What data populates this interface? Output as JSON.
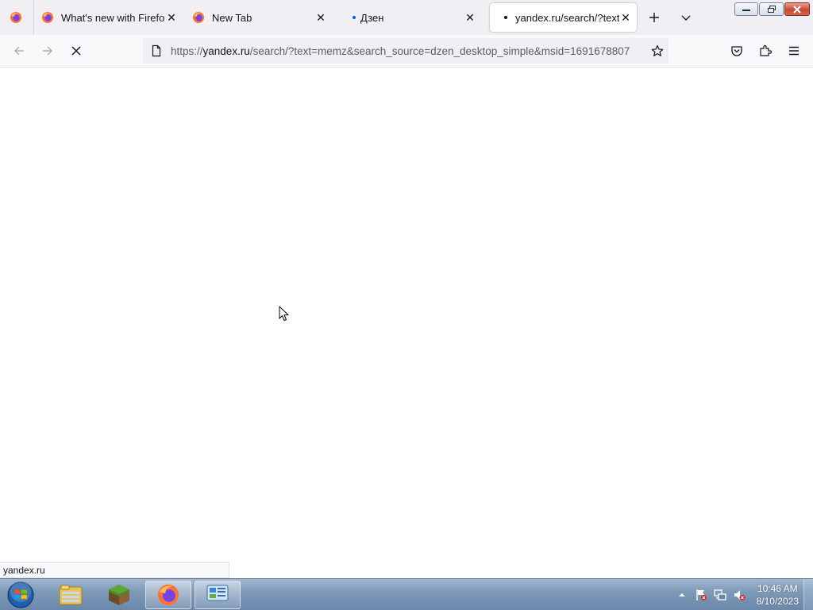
{
  "tabs": [
    {
      "label": "What's new with Firefox - Mo",
      "icon": "firefox-icon",
      "active": false
    },
    {
      "label": "New Tab",
      "icon": "firefox-icon",
      "active": false
    },
    {
      "label": "Дзен",
      "icon": "loading-dot-icon",
      "active": false
    },
    {
      "label": "yandex.ru/search/?text=mem",
      "icon": "loading-dot-icon",
      "active": true
    }
  ],
  "window_controls": [
    "minimize",
    "restore",
    "close"
  ],
  "url": {
    "prefix": "https://",
    "host": "yandex.ru",
    "path": "/search/?text=memz&search_source=dzen_desktop_simple&msid=1691678807"
  },
  "status_text": "yandex.ru",
  "taskbar": {
    "items": [
      {
        "name": "file-explorer",
        "icon": "folder-icon",
        "running": false
      },
      {
        "name": "minecraft",
        "icon": "grass-block-icon",
        "running": false
      },
      {
        "name": "firefox",
        "icon": "firefox-icon",
        "running": true
      },
      {
        "name": "control-panel",
        "icon": "control-panel-icon",
        "running": true
      }
    ],
    "clock": {
      "time": "10:46 AM",
      "date": "8/10/2023"
    }
  },
  "colors": {
    "accent_dot": "#0060df",
    "tab_strip": "#f0f0f4",
    "nav_bar": "#f9f9fb",
    "taskbar": "#7f9ab8"
  }
}
